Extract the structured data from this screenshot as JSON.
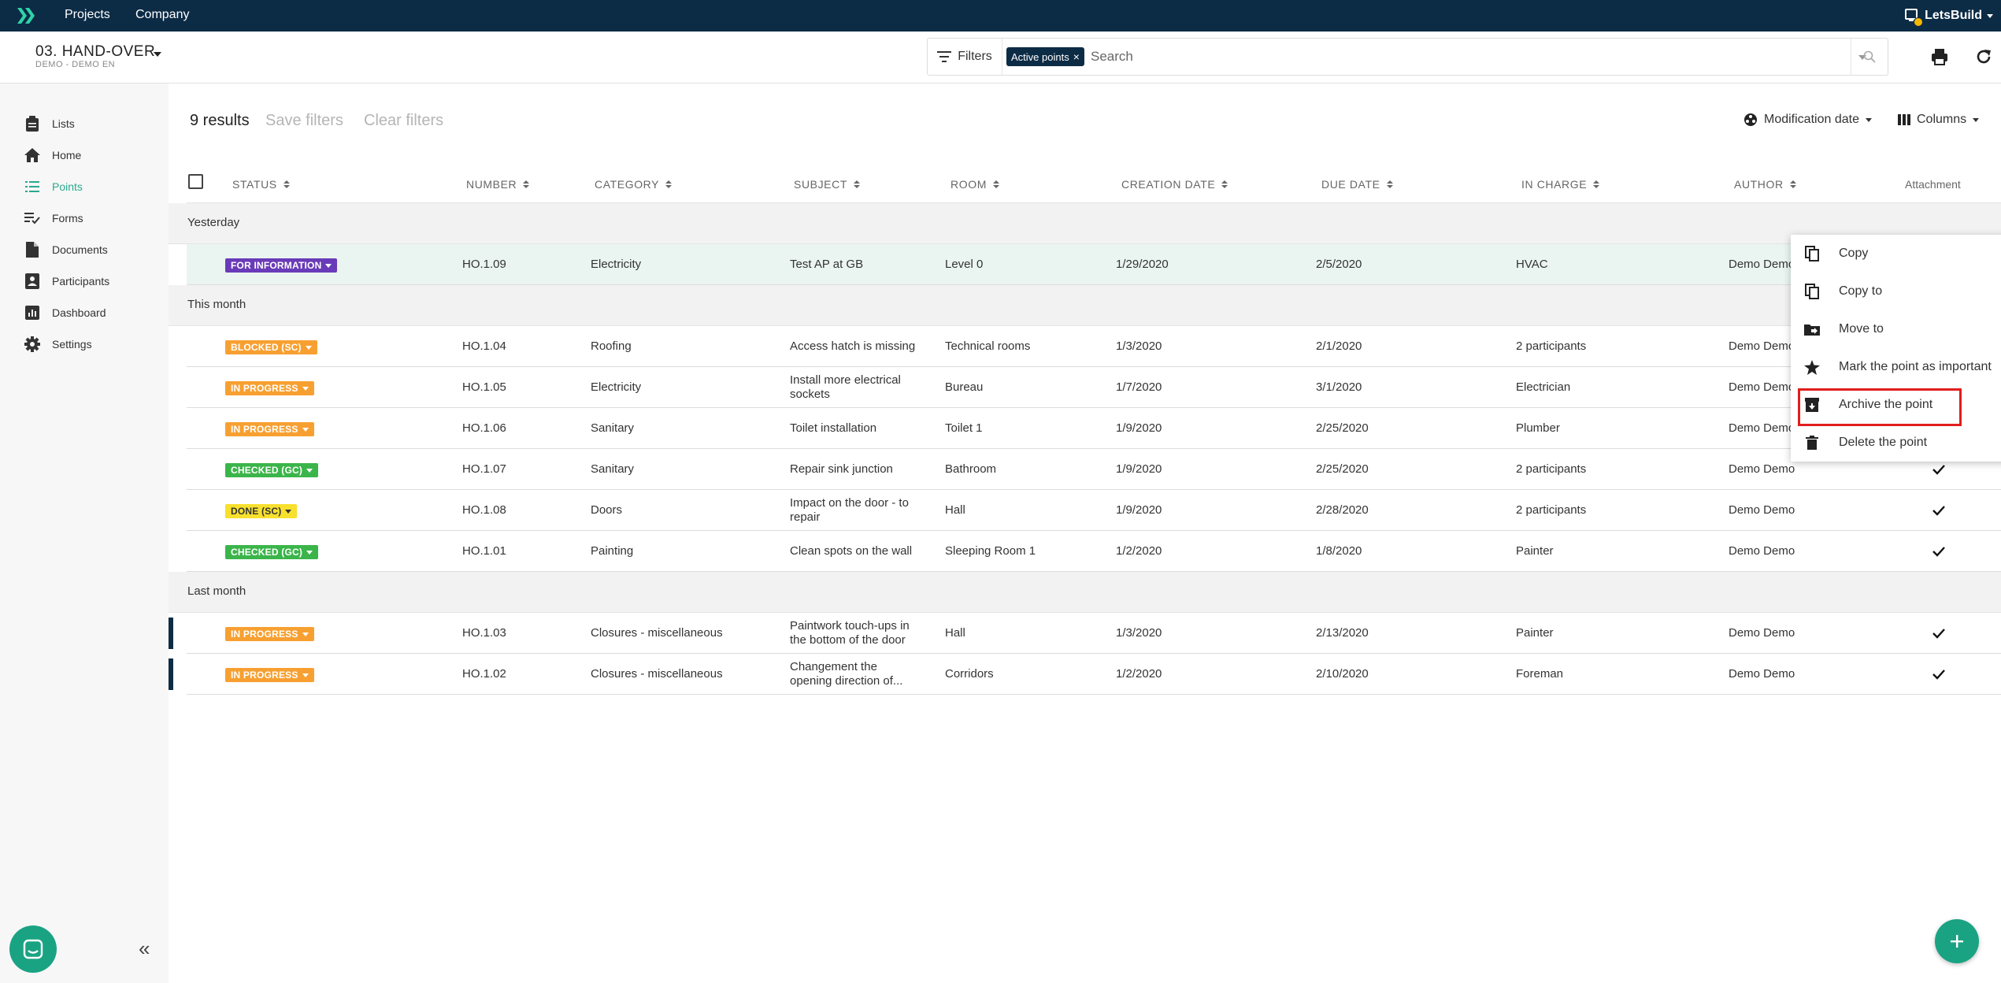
{
  "topbar": {
    "nav": [
      "Projects",
      "Company"
    ],
    "user_name": "LetsBuild",
    "notification_count": ""
  },
  "project": {
    "name": "03. HAND-OVER",
    "subtitle": "DEMO - DEMO EN"
  },
  "filterbar": {
    "filters_label": "Filters",
    "active_chip": "Active points",
    "search_placeholder": "Search"
  },
  "sidebar": {
    "items": [
      {
        "label": "Lists",
        "icon": "clipboard-icon"
      },
      {
        "label": "Home",
        "icon": "home-icon"
      },
      {
        "label": "Points",
        "icon": "list-icon",
        "active": true
      },
      {
        "label": "Forms",
        "icon": "form-icon"
      },
      {
        "label": "Documents",
        "icon": "document-icon"
      },
      {
        "label": "Participants",
        "icon": "participants-icon"
      },
      {
        "label": "Dashboard",
        "icon": "dashboard-icon"
      },
      {
        "label": "Settings",
        "icon": "gear-icon"
      }
    ]
  },
  "toolbar": {
    "results": "9 results",
    "save_filters": "Save filters",
    "clear_filters": "Clear filters",
    "sort_label": "Modification date",
    "columns_label": "Columns"
  },
  "table": {
    "headers": {
      "status": "STATUS",
      "number": "NUMBER",
      "category": "CATEGORY",
      "subject": "SUBJECT",
      "room": "ROOM",
      "creation_date": "CREATION DATE",
      "due_date": "DUE DATE",
      "in_charge": "IN CHARGE",
      "author": "AUTHOR",
      "attachment": "Attachment"
    },
    "groups": [
      "Yesterday",
      "This month",
      "Last month"
    ],
    "rows": [
      {
        "status": "FOR INFORMATION",
        "status_color": "#6a3bb8",
        "number": "HO.1.09",
        "category": "Electricity",
        "subject": "Test AP at GB",
        "room": "Level 0",
        "creation_date": "1/29/2020",
        "due_date": "2/5/2020",
        "in_charge": "HVAC",
        "author": "Demo Demo",
        "attachment": false
      },
      {
        "status": "BLOCKED (SC)",
        "status_color": "#f7a031",
        "number": "HO.1.04",
        "category": "Roofing",
        "subject": "Access hatch is missing",
        "room": "Technical rooms",
        "creation_date": "1/3/2020",
        "due_date": "2/1/2020",
        "in_charge": "2 participants",
        "author": "Demo Demo",
        "attachment": false
      },
      {
        "status": "IN PROGRESS",
        "status_color": "#f7a031",
        "number": "HO.1.05",
        "category": "Electricity",
        "subject": "Install more electrical sockets",
        "room": "Bureau",
        "creation_date": "1/7/2020",
        "due_date": "3/1/2020",
        "in_charge": "Electrician",
        "author": "Demo Demo",
        "attachment": false
      },
      {
        "status": "IN PROGRESS",
        "status_color": "#f7a031",
        "number": "HO.1.06",
        "category": "Sanitary",
        "subject": "Toilet installation",
        "room": "Toilet 1",
        "creation_date": "1/9/2020",
        "due_date": "2/25/2020",
        "in_charge": "Plumber",
        "author": "Demo Demo",
        "attachment": false
      },
      {
        "status": "CHECKED (GC)",
        "status_color": "#3bb54a",
        "number": "HO.1.07",
        "category": "Sanitary",
        "subject": "Repair sink junction",
        "room": "Bathroom",
        "creation_date": "1/9/2020",
        "due_date": "2/25/2020",
        "in_charge": "2 participants",
        "author": "Demo Demo",
        "attachment": true
      },
      {
        "status": "DONE (SC)",
        "status_color": "#f7e02e",
        "status_text_color": "#333",
        "number": "HO.1.08",
        "category": "Doors",
        "subject": "Impact on the door - to repair",
        "room": "Hall",
        "creation_date": "1/9/2020",
        "due_date": "2/28/2020",
        "in_charge": "2 participants",
        "author": "Demo Demo",
        "attachment": true
      },
      {
        "status": "CHECKED (GC)",
        "status_color": "#3bb54a",
        "number": "HO.1.01",
        "category": "Painting",
        "subject": "Clean spots on the wall",
        "room": "Sleeping Room 1",
        "creation_date": "1/2/2020",
        "due_date": "1/8/2020",
        "in_charge": "Painter",
        "author": "Demo Demo",
        "attachment": true
      },
      {
        "status": "IN PROGRESS",
        "status_color": "#f7a031",
        "number": "HO.1.03",
        "category": "Closures - miscellaneous",
        "subject": "Paintwork touch-ups in the bottom of the door",
        "room": "Hall",
        "creation_date": "1/3/2020",
        "due_date": "2/13/2020",
        "in_charge": "Painter",
        "author": "Demo Demo",
        "attachment": true
      },
      {
        "status": "IN PROGRESS",
        "status_color": "#f7a031",
        "number": "HO.1.02",
        "category": "Closures - miscellaneous",
        "subject": "Changement the opening direction of...",
        "room": "Corridors",
        "creation_date": "1/2/2020",
        "due_date": "2/10/2020",
        "in_charge": "Foreman",
        "author": "Demo Demo",
        "attachment": true
      }
    ]
  },
  "context_menu": {
    "items": [
      {
        "label": "Copy",
        "icon": "copy-icon"
      },
      {
        "label": "Copy to",
        "icon": "copy-to-icon"
      },
      {
        "label": "Move to",
        "icon": "move-folder-icon"
      },
      {
        "label": "Mark the point as important",
        "icon": "star-icon"
      },
      {
        "label": "Archive the point",
        "icon": "archive-icon",
        "highlighted": true
      },
      {
        "label": "Delete the point",
        "icon": "trash-icon"
      }
    ]
  },
  "colors": {
    "topbar": "#0c2b45",
    "accent": "#1aa383",
    "highlight_box": "#e11d1d"
  }
}
